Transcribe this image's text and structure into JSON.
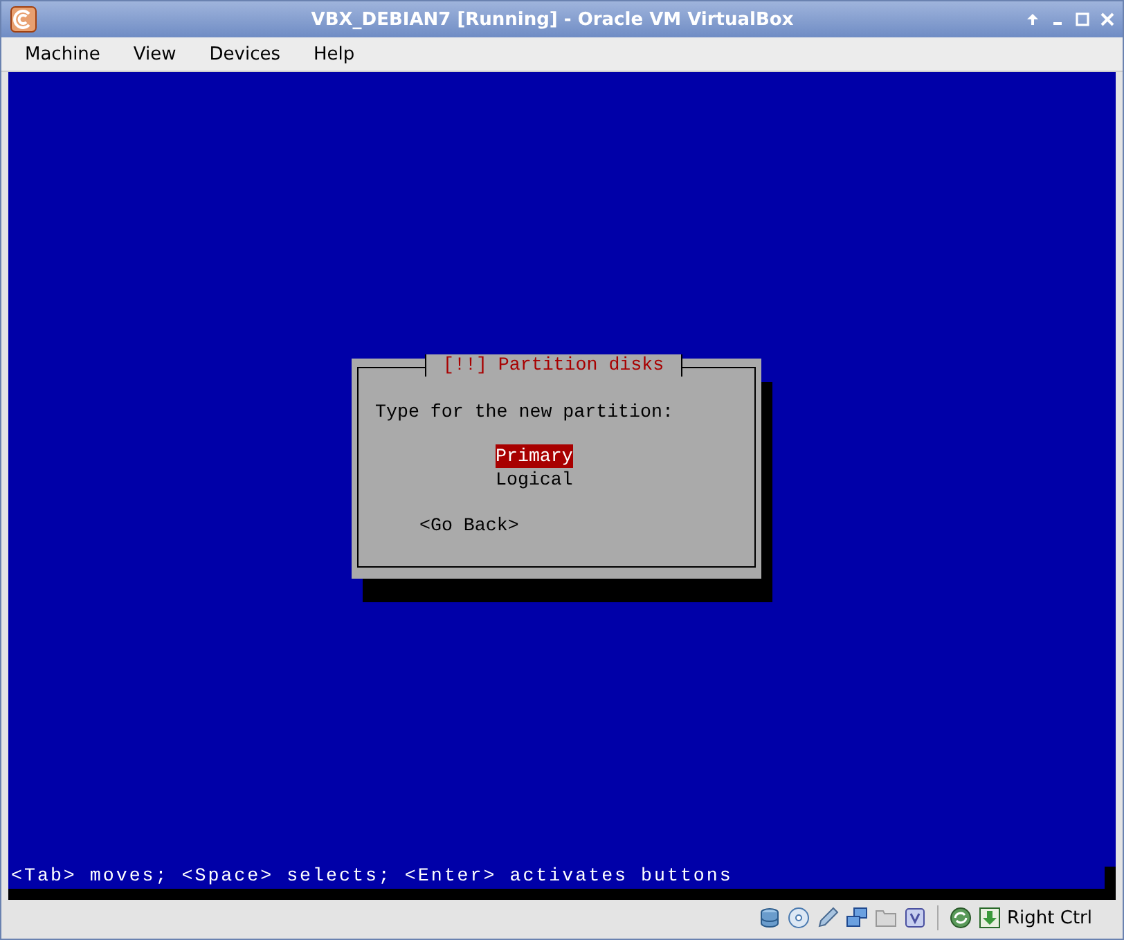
{
  "window": {
    "title": "VBX_DEBIAN7 [Running] - Oracle VM VirtualBox"
  },
  "menu": [
    "Machine",
    "View",
    "Devices",
    "Help"
  ],
  "dialog": {
    "title": "[!!] Partition disks",
    "prompt": "Type for the new partition:",
    "options": [
      {
        "label": "Primary",
        "selected": true
      },
      {
        "label": "Logical",
        "selected": false
      }
    ],
    "button": "<Go Back>"
  },
  "console_hint": "<Tab> moves; <Space> selects; <Enter> activates buttons",
  "status_bar": {
    "host_key": "Right Ctrl"
  }
}
